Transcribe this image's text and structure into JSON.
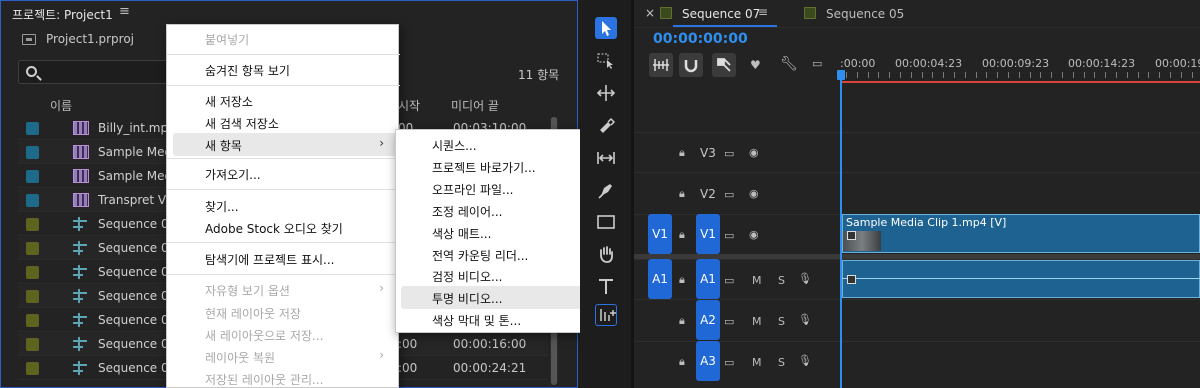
{
  "project": {
    "title": "프로젝트: Project1",
    "menu_icon": "hamburger-icon",
    "file_name": "Project1.prproj",
    "item_count": "11 항목",
    "columns": {
      "name": "이름",
      "start": "시작",
      "end": "미디어 끝"
    },
    "items": [
      {
        "name": "Billy_int.mp4",
        "type": "clip",
        "color": "#1d6a8a",
        "start": "00",
        "end": "00:03:10:00"
      },
      {
        "name": "Sample Media Clip",
        "type": "clip",
        "color": "#1d6a8a",
        "start": "",
        "end": ""
      },
      {
        "name": "Sample Media Clip",
        "type": "clip",
        "color": "#1d6a8a",
        "start": "",
        "end": ""
      },
      {
        "name": "Transpret Video",
        "type": "clip",
        "color": "#1d6a8a",
        "start": "",
        "end": ""
      },
      {
        "name": "Sequence 01",
        "type": "sequence",
        "color": "#5d6420",
        "start": "",
        "end": ""
      },
      {
        "name": "Sequence 02",
        "type": "sequence",
        "color": "#5d6420",
        "start": "",
        "end": ""
      },
      {
        "name": "Sequence 03",
        "type": "sequence",
        "color": "#5d6420",
        "start": "",
        "end": ""
      },
      {
        "name": "Sequence 04",
        "type": "sequence",
        "color": "#5d6420",
        "start": "",
        "end": ""
      },
      {
        "name": "Sequence 05",
        "type": "sequence",
        "color": "#5d6420",
        "start": "",
        "end": ""
      },
      {
        "name": "Sequence 06",
        "type": "sequence",
        "color": "#5d6420",
        "start": ":00",
        "end": "00:00:16:00"
      },
      {
        "name": "Sequence 07",
        "type": "sequence",
        "color": "#5d6420",
        "start": ":00",
        "end": "00:00:24:21"
      }
    ]
  },
  "context_menu": {
    "items": [
      {
        "label": "붙여넣기",
        "disabled": true
      },
      {
        "label": "숨겨진 항목 보기",
        "disabled": false
      },
      {
        "label": "새 저장소",
        "disabled": false
      },
      {
        "label": "새 검색 저장소",
        "disabled": false
      },
      {
        "label": "새 항목",
        "disabled": false,
        "submenu": true,
        "highlighted": true
      },
      {
        "label": "가져오기...",
        "disabled": false
      },
      {
        "label": "찾기...",
        "disabled": false
      },
      {
        "label": "Adobe Stock 오디오 찾기",
        "disabled": false
      },
      {
        "label": "탐색기에 프로젝트 표시...",
        "disabled": false
      },
      {
        "label": "자유형 보기 옵션",
        "disabled": true,
        "submenu": true
      },
      {
        "label": "현재 레이아웃 저장",
        "disabled": true
      },
      {
        "label": "새 레이아웃으로 저장...",
        "disabled": true
      },
      {
        "label": "레이아웃 복원",
        "disabled": true,
        "submenu": true
      },
      {
        "label": "저장된 레이아웃 관리...",
        "disabled": true
      }
    ]
  },
  "submenu": {
    "items": [
      "시퀀스...",
      "프로젝트 바로가기...",
      "오프라인 파일...",
      "조정 레이어...",
      "색상 매트...",
      "전역 카운팅 리더...",
      "검정 비디오...",
      "투명 비디오...",
      "색상 막대 및 톤..."
    ],
    "highlighted": "투명 비디오..."
  },
  "tools": [
    "selection-tool",
    "track-select-tool",
    "ripple-edit-tool",
    "razor-tool",
    "slip-tool",
    "pen-tool",
    "rectangle-tool",
    "hand-tool",
    "type-tool",
    "remix-tool"
  ],
  "timeline": {
    "tabs": [
      {
        "label": "Sequence 07",
        "active": true,
        "close": "×",
        "menu": "≡"
      },
      {
        "label": "Sequence 05",
        "active": false
      }
    ],
    "timecode": "00:00:00:00",
    "ruler": [
      ":00:00",
      "00:00:04:23",
      "00:00:09:23",
      "00:00:14:23",
      "00:00:19"
    ],
    "tracks": [
      {
        "patch": "",
        "label": "V3"
      },
      {
        "patch": "",
        "label": "V2"
      },
      {
        "patch": "V1",
        "label": "V1"
      },
      {
        "patch": "A1",
        "label": "A1",
        "m": "M",
        "s": "S"
      },
      {
        "patch": "",
        "label": "A2",
        "m": "M",
        "s": "S"
      },
      {
        "patch": "",
        "label": "A3",
        "m": "M",
        "s": "S"
      }
    ],
    "clip_title": "Sample Media Clip 1.mp4 [V]",
    "accent": "#2b73e0",
    "clip_color": "#1d6290"
  }
}
